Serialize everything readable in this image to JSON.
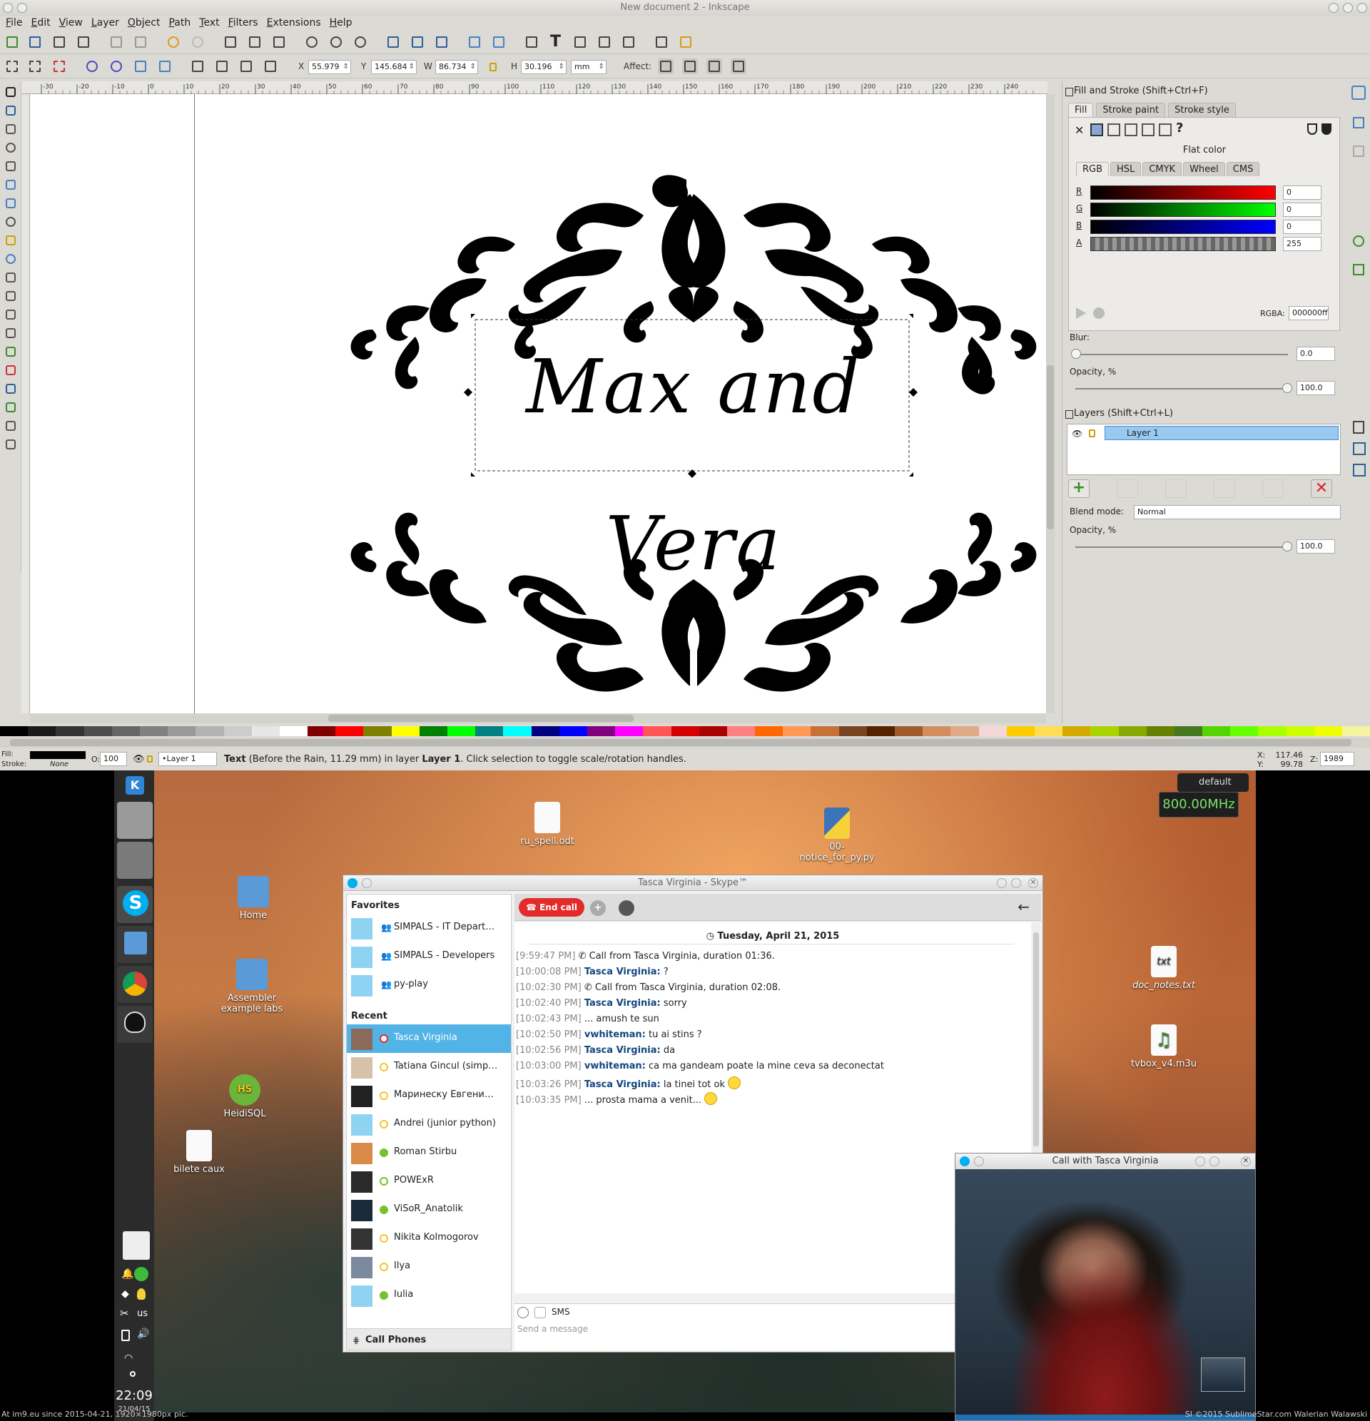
{
  "inkscape": {
    "title": "New document 2 - Inkscape",
    "menu": [
      "File",
      "Edit",
      "View",
      "Layer",
      "Object",
      "Path",
      "Text",
      "Filters",
      "Extensions",
      "Help"
    ],
    "coords": {
      "x_label": "X",
      "x": "55.979",
      "y_label": "Y",
      "y": "145.684",
      "w_label": "W",
      "w": "86.734",
      "h_label": "H",
      "h": "30.196",
      "unit": "mm",
      "affect_label": "Affect:"
    },
    "ruler_ticks": [
      "-30",
      "-20",
      "-10",
      "0",
      "10",
      "20",
      "30",
      "40",
      "50",
      "60",
      "70",
      "80",
      "90",
      "100",
      "110",
      "120",
      "130",
      "140",
      "150",
      "160",
      "170",
      "180",
      "190",
      "200",
      "210",
      "220",
      "230",
      "240"
    ],
    "canvas_text": "Max and Vera",
    "fill_stroke": {
      "title": "Fill and Stroke (Shift+Ctrl+F)",
      "tabs": [
        "Fill",
        "Stroke paint",
        "Stroke style"
      ],
      "flat_color_label": "Flat color",
      "mode_tabs": [
        "RGB",
        "HSL",
        "CMYK",
        "Wheel",
        "CMS"
      ],
      "channels": [
        {
          "label": "R",
          "value": "0"
        },
        {
          "label": "G",
          "value": "0"
        },
        {
          "label": "B",
          "value": "0"
        },
        {
          "label": "A",
          "value": "255"
        }
      ],
      "rgba_label": "RGBA:",
      "rgba_value": "000000ff",
      "blur_label": "Blur:",
      "blur_value": "0.0",
      "opacity_label": "Opacity, %",
      "opacity_value": "100.0",
      "unknown_glyph": "?"
    },
    "layers": {
      "title": "Layers (Shift+Ctrl+L)",
      "layer_name": "Layer 1",
      "blend_label": "Blend mode:",
      "blend_value": "Normal",
      "opacity_label": "Opacity, %",
      "opacity_value": "100.0"
    },
    "status": {
      "fill_label": "Fill:",
      "stroke_label": "Stroke:",
      "stroke_value": "None",
      "opacity_label": "O:",
      "opacity_value": "100",
      "layer_select": "•Layer 1",
      "message_bold": "Text",
      "message_mid": " (Before the Rain, 11.29 mm) in layer ",
      "message_layer": "Layer 1",
      "message_end": ". Click selection to toggle scale/rotation handles.",
      "cursor_x_label": "X:",
      "cursor_x": "117.46",
      "cursor_y_label": "Y:",
      "cursor_y": "99.78",
      "zoom_label": "Z:",
      "zoom": "1989"
    },
    "colors": {
      "palette": [
        "#000000",
        "#1a1a1a",
        "#333333",
        "#4d4d4d",
        "#666666",
        "#808080",
        "#999999",
        "#b3b3b3",
        "#cccccc",
        "#e6e6e6",
        "#ffffff",
        "#800000",
        "#ff0000",
        "#808000",
        "#ffff00",
        "#008000",
        "#00ff00",
        "#008080",
        "#00ffff",
        "#000080",
        "#0000ff",
        "#800080",
        "#ff00ff",
        "#ff5555",
        "#d40000",
        "#aa0000",
        "#ff8080",
        "#ff6600",
        "#ff9955",
        "#c87137",
        "#784421",
        "#552200",
        "#a05a2c",
        "#d38d5f",
        "#deaa87",
        "#f4d7d7",
        "#ffcc00",
        "#ffdd55",
        "#d4aa00",
        "#aad400",
        "#88aa00",
        "#668000",
        "#447821",
        "#55d400",
        "#66ff00",
        "#aaff00",
        "#ccff00",
        "#eeff00",
        "#f4f4a0"
      ]
    }
  },
  "desktop": {
    "cpu_profile": "default",
    "cpu_freq": "800.00MHz",
    "icons": [
      {
        "label": "ru_spell.odt"
      },
      {
        "label": "00-notice_for_py.py"
      },
      {
        "label": "Home"
      },
      {
        "label": "Assembler example labs"
      },
      {
        "label": "HeidiSQL"
      },
      {
        "label": "bilete caux"
      },
      {
        "label": "doc_notes.txt"
      },
      {
        "label": "tvbox_v4.m3u"
      }
    ],
    "heidisql_badge": "HS",
    "txt_badge": "txt",
    "tray": {
      "kbd": "us",
      "time": "22:09",
      "date": "21/04/15"
    },
    "watermark_left": "At im9.eu since 2015-04-21, 1920×1980px pic.",
    "watermark_right": "SI ©2015 SublimeStar.com Walerian Walawski"
  },
  "skype": {
    "title": "Tasca Virginia - Skype™",
    "favorites_heading": "Favorites",
    "favorites": [
      "SIMPALS - IT Depart…",
      "SIMPALS - Developers",
      "py-play"
    ],
    "recent_heading": "Recent",
    "recent": [
      "Tasca Virginia",
      "Tatiana Gincul (simp…",
      "Маринеску Евгени…",
      "Andrei (junior python)",
      "Roman  Stirbu",
      "POWExR",
      "ViSoR_Anatolik",
      "Nikita Kolmogorov",
      "Ilya",
      "Iulia"
    ],
    "call_phones": "Call Phones",
    "end_call": "End call",
    "date_header": "Tuesday, April 21, 2015",
    "messages": [
      {
        "ts": "[9:59:47 PM]",
        "who": "",
        "text": "Call from Tasca Virginia, duration 01:36."
      },
      {
        "ts": "[10:00:08 PM]",
        "who": "Tasca Virginia:",
        "text": " ?"
      },
      {
        "ts": "[10:02:30 PM]",
        "who": "",
        "text": "Call from Tasca Virginia, duration 02:08."
      },
      {
        "ts": "[10:02:40 PM]",
        "who": "Tasca Virginia:",
        "text": " sorry"
      },
      {
        "ts": "[10:02:43 PM]",
        "who": "",
        "text": "... amush te sun"
      },
      {
        "ts": "[10:02:50 PM]",
        "who": "vwhiteman:",
        "text": " tu ai stins ?"
      },
      {
        "ts": "[10:02:56 PM]",
        "who": "Tasca Virginia:",
        "text": " da"
      },
      {
        "ts": "[10:03:00 PM]",
        "who": "vwhiteman:",
        "text": " ca ma gandeam poate la mine ceva sa deconectat"
      },
      {
        "ts": "[10:03:26 PM]",
        "who": "Tasca Virginia:",
        "text": " la tinei tot ok"
      },
      {
        "ts": "[10:03:35 PM]",
        "who": "",
        "text": "... prosta mama a venit..."
      }
    ],
    "sms_label": "SMS",
    "input_placeholder": "Send a message",
    "call_window_title": "Call with Tasca Virginia"
  }
}
